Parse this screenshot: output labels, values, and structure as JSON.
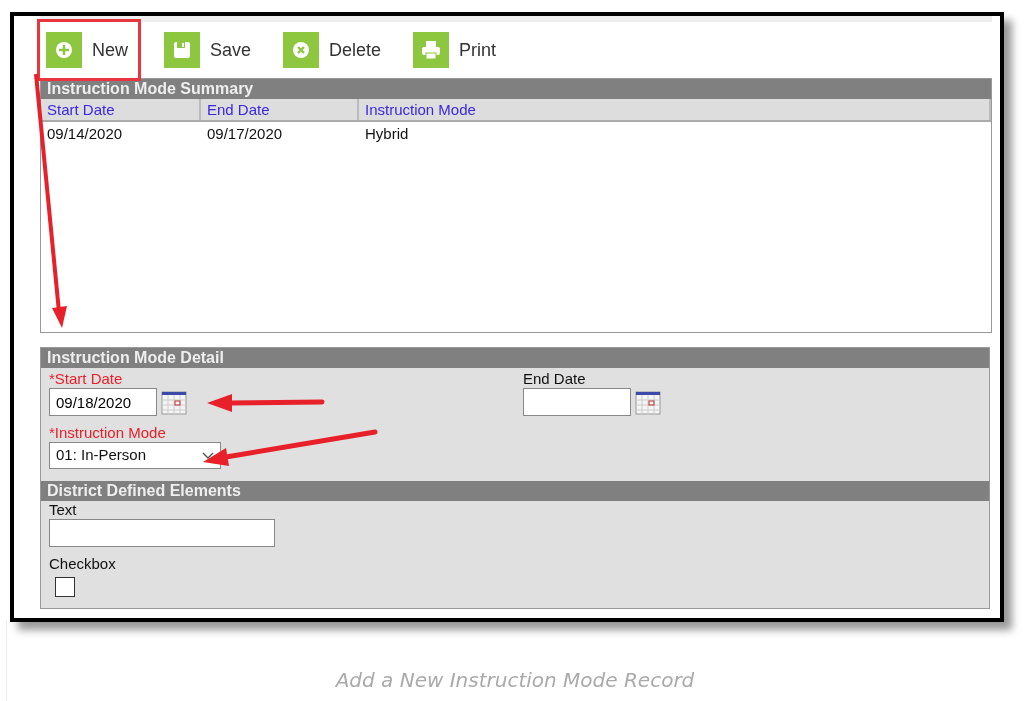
{
  "toolbar": [
    {
      "label": "New",
      "kind": "new",
      "highlighted": true
    },
    {
      "label": "Save",
      "kind": "save",
      "highlighted": false
    },
    {
      "label": "Delete",
      "kind": "delete",
      "highlighted": false
    },
    {
      "label": "Print",
      "kind": "print",
      "highlighted": false
    }
  ],
  "summary": {
    "title": "Instruction Mode Summary",
    "columns": [
      "Start Date",
      "End Date",
      "Instruction Mode"
    ],
    "rows": [
      [
        "09/14/2020",
        "09/17/2020",
        "Hybrid"
      ]
    ]
  },
  "detail": {
    "title": "Instruction Mode Detail",
    "start_date": {
      "label": "*Start Date",
      "value": "09/18/2020",
      "required": true
    },
    "end_date": {
      "label": "End Date",
      "required": false
    },
    "instruction_mode": {
      "label": "*Instruction Mode",
      "value": "01: In-Person",
      "required": true
    }
  },
  "district": {
    "title": "District Defined Elements",
    "text_label": "Text",
    "checkbox_label": "Checkbox",
    "checkbox_checked": false
  },
  "caption": "Add a New Instruction Mode Record"
}
